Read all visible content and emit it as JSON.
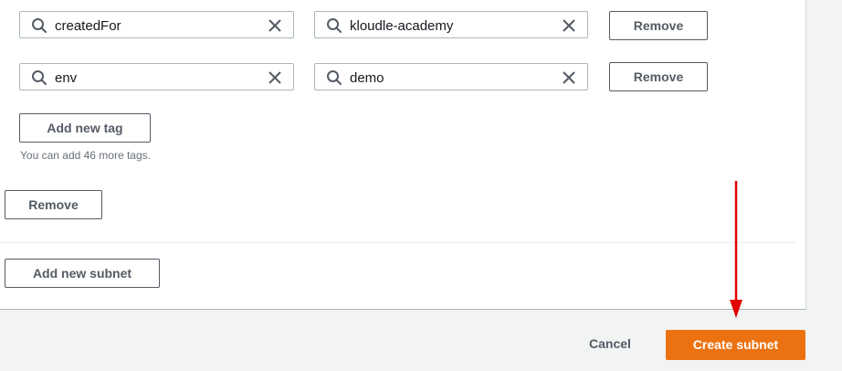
{
  "tags": [
    {
      "key": "createdFor",
      "value": "kloudle-academy",
      "remove_label": "Remove"
    },
    {
      "key": "env",
      "value": "demo",
      "remove_label": "Remove"
    }
  ],
  "add_tag_label": "Add new tag",
  "tags_hint": "You can add 46 more tags.",
  "remove_subnet_label": "Remove",
  "add_subnet_label": "Add new subnet",
  "footer": {
    "cancel_label": "Cancel",
    "create_label": "Create subnet"
  },
  "colors": {
    "primary": "#ec7211",
    "annotation_arrow": "#e00000"
  },
  "icons": {
    "search": "search-icon",
    "clear": "close-icon",
    "arrow": "red-annotation-arrow"
  }
}
